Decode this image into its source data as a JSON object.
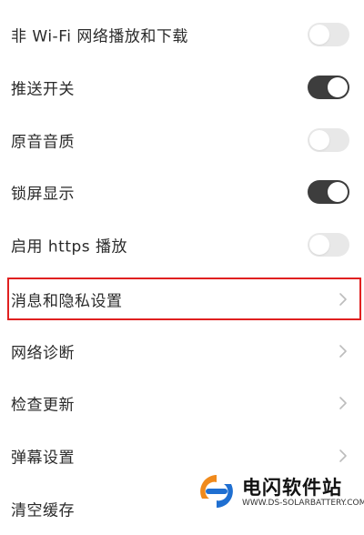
{
  "settings": {
    "items": [
      {
        "label": "非 Wi-Fi 网络播放和下载",
        "control": "toggle",
        "on": false
      },
      {
        "label": "推送开关",
        "control": "toggle",
        "on": true
      },
      {
        "label": "原音音质",
        "control": "toggle",
        "on": false
      },
      {
        "label": "锁屏显示",
        "control": "toggle",
        "on": true
      },
      {
        "label": "启用 https 播放",
        "control": "toggle",
        "on": false
      },
      {
        "label": "消息和隐私设置",
        "control": "chevron",
        "highlighted": true
      },
      {
        "label": "网络诊断",
        "control": "chevron"
      },
      {
        "label": "检查更新",
        "control": "chevron"
      },
      {
        "label": "弹幕设置",
        "control": "chevron"
      },
      {
        "label": "清空缓存",
        "control": "none"
      }
    ]
  },
  "colors": {
    "toggle_on": "#3d3d3d",
    "toggle_off": "#e8e8e8",
    "highlight_border": "#e02020",
    "chevron": "#bcbcbc"
  },
  "watermark": {
    "title": "电闪软件站",
    "url": "WWW.DS-SOLARBATTERY.COM",
    "logo_colors": [
      "#f08a1c",
      "#1f6fd1"
    ]
  }
}
